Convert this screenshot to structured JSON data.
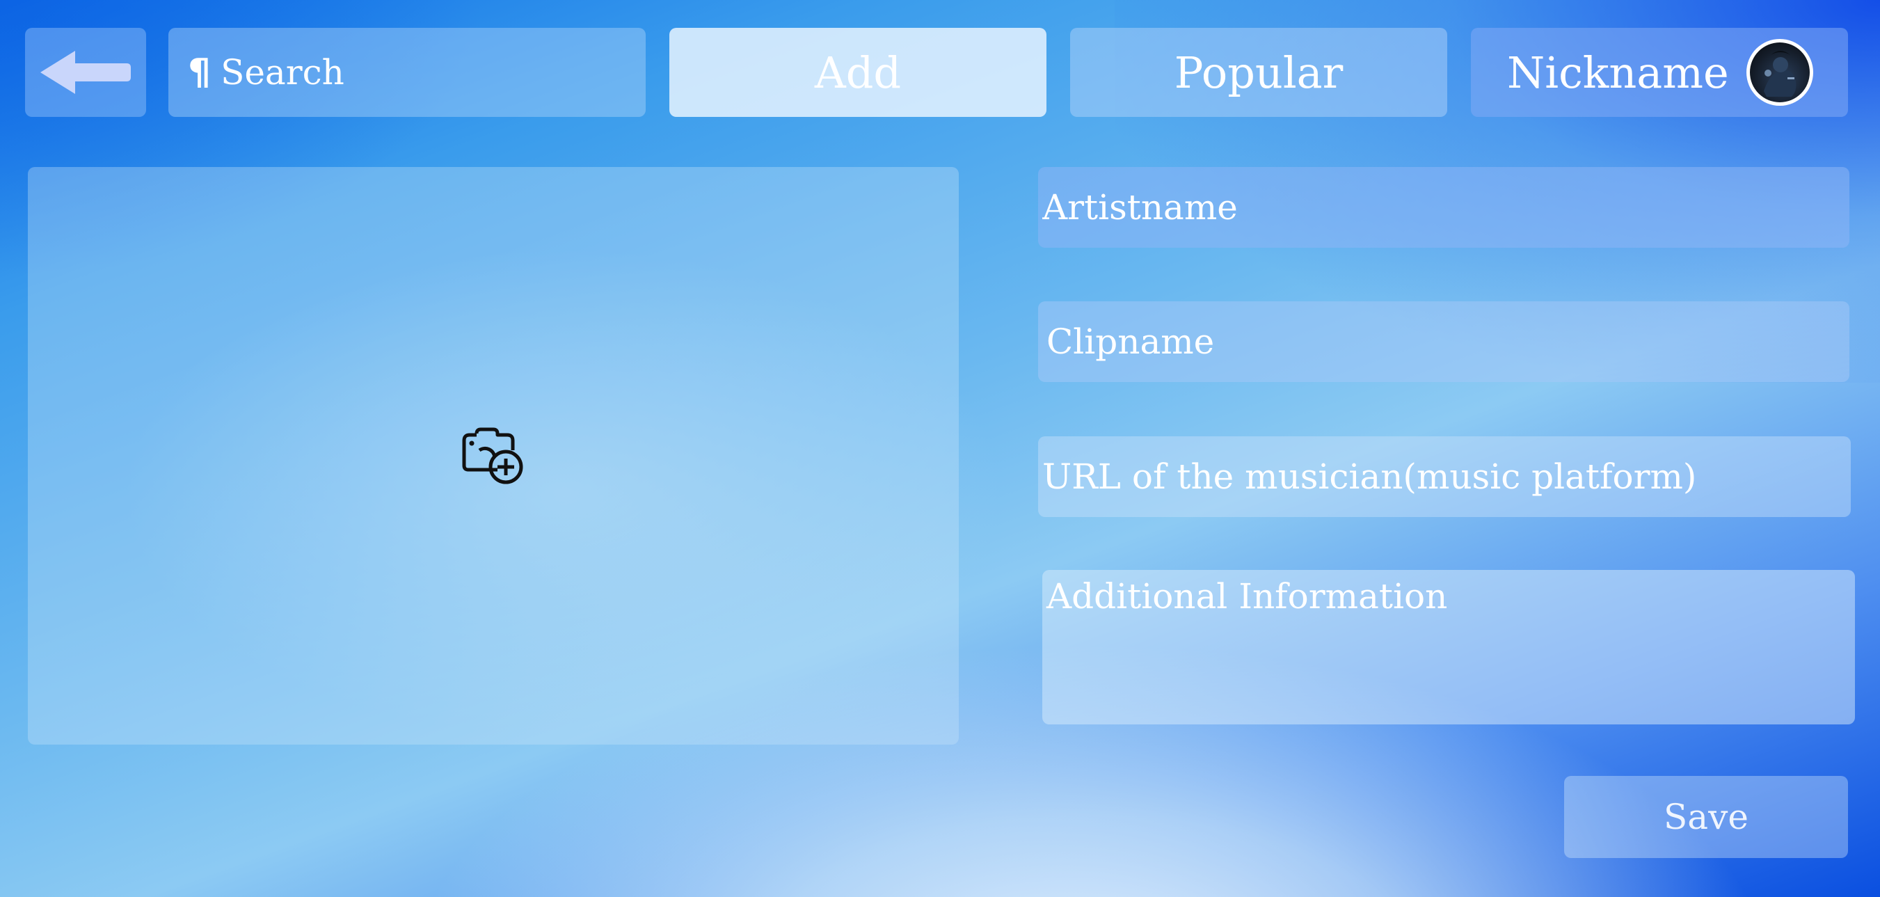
{
  "nav": {
    "back_icon": "back-arrow-icon",
    "search_icon": "pilcrow-icon",
    "search_placeholder": "Search",
    "add_label": "Add",
    "popular_label": "Popular",
    "nickname": "Nickname",
    "avatar_icon": "user-avatar"
  },
  "upload": {
    "icon": "camera-add-icon"
  },
  "form": {
    "artist_placeholder": "Artistname",
    "clip_placeholder": "Clipname",
    "url_placeholder": "URL of the musician(music platform)",
    "info_placeholder": "Additional Information",
    "save_label": "Save"
  },
  "colors": {
    "accent_blue": "#1565e8",
    "text": "#ffffff"
  }
}
